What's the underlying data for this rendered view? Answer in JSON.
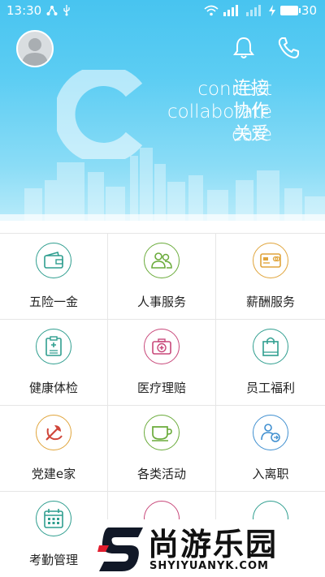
{
  "status_bar": {
    "time": "13:30",
    "battery_level": "30"
  },
  "header": {
    "tagline_en": [
      "connect",
      "collaborate",
      "care"
    ],
    "tagline_cn": [
      "连接",
      "协作",
      "关爱"
    ],
    "icons": [
      "bell-icon",
      "phone-icon"
    ]
  },
  "menu": [
    {
      "label": "五险一金",
      "icon": "wallet-icon",
      "color": "#2f9e8f"
    },
    {
      "label": "人事服务",
      "icon": "people-icon",
      "color": "#6aab3a"
    },
    {
      "label": "薪酬服务",
      "icon": "card-icon",
      "color": "#e0a43a"
    },
    {
      "label": "健康体检",
      "icon": "clipboard-icon",
      "color": "#2f9e8f"
    },
    {
      "label": "医疗理赔",
      "icon": "medkit-icon",
      "color": "#c8487a"
    },
    {
      "label": "员工福利",
      "icon": "bag-icon",
      "color": "#2f9e8f"
    },
    {
      "label": "党建e家",
      "icon": "party-icon",
      "color": "#e0a43a"
    },
    {
      "label": "各类活动",
      "icon": "cup-icon",
      "color": "#6aab3a"
    },
    {
      "label": "入离职",
      "icon": "person-arrow-icon",
      "color": "#3f8fd0"
    },
    {
      "label": "考勤管理",
      "icon": "calendar-icon",
      "color": "#2f9e8f"
    },
    {
      "label": "",
      "icon": "partial-icon",
      "color": "#c8487a"
    },
    {
      "label": "",
      "icon": "partial-icon",
      "color": "#2f9e8f"
    }
  ],
  "watermark": {
    "cn": "尚游乐园",
    "en": "SHYIYUANYK.COM"
  }
}
